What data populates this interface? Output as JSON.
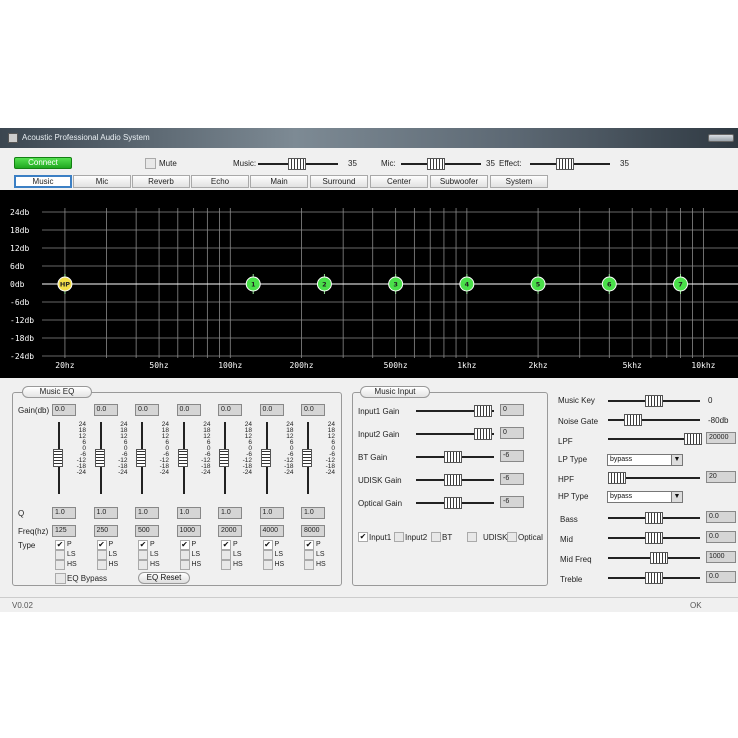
{
  "window": {
    "title": "Acoustic Professional Audio System"
  },
  "top": {
    "connect_label": "Connect",
    "mute_label": "Mute",
    "music_label": "Music:",
    "music_value": "35",
    "mic_label": "Mic:",
    "mic_value": "35",
    "effect_label": "Effect:",
    "effect_value": "35"
  },
  "tabs": [
    "Music",
    "Mic",
    "Reverb",
    "Echo",
    "Main",
    "Surround",
    "Center",
    "Subwoofer",
    "System"
  ],
  "selected_tab": "Music",
  "graph": {
    "db_labels": [
      "24db",
      "18db",
      "12db",
      "6db",
      "0db",
      "-6db",
      "-12db",
      "-18db",
      "-24db"
    ],
    "freq_labels": [
      "20hz",
      "50hz",
      "100hz",
      "200hz",
      "500hz",
      "1khz",
      "2khz",
      "5khz",
      "10khz"
    ],
    "points": [
      {
        "label": "HP",
        "freq_hz": 20,
        "gain_db": 0,
        "color": "#f4e04a"
      },
      {
        "label": "1",
        "freq_hz": 125,
        "gain_db": 0,
        "color": "#4ae04a"
      },
      {
        "label": "2",
        "freq_hz": 250,
        "gain_db": 0,
        "color": "#4ae04a"
      },
      {
        "label": "3",
        "freq_hz": 500,
        "gain_db": 0,
        "color": "#4ae04a"
      },
      {
        "label": "4",
        "freq_hz": 1000,
        "gain_db": 0,
        "color": "#4ae04a"
      },
      {
        "label": "5",
        "freq_hz": 2000,
        "gain_db": 0,
        "color": "#4ae04a"
      },
      {
        "label": "6",
        "freq_hz": 4000,
        "gain_db": 0,
        "color": "#4ae04a"
      },
      {
        "label": "7",
        "freq_hz": 8000,
        "gain_db": 0,
        "color": "#4ae04a"
      }
    ]
  },
  "music_eq": {
    "title": "Music EQ",
    "gain_label": "Gain(db)",
    "q_label": "Q",
    "freq_label": "Freq(hz)",
    "type_label": "Type",
    "scale_labels": [
      "24",
      "18",
      "12",
      "6",
      "0",
      "-6",
      "-12",
      "-18",
      "-24"
    ],
    "type_options": [
      "P",
      "LS",
      "HS"
    ],
    "bands": [
      {
        "gain": "0.0",
        "q": "1.0",
        "freq": "125"
      },
      {
        "gain": "0.0",
        "q": "1.0",
        "freq": "250"
      },
      {
        "gain": "0.0",
        "q": "1.0",
        "freq": "500"
      },
      {
        "gain": "0.0",
        "q": "1.0",
        "freq": "1000"
      },
      {
        "gain": "0.0",
        "q": "1.0",
        "freq": "2000"
      },
      {
        "gain": "0.0",
        "q": "1.0",
        "freq": "4000"
      },
      {
        "gain": "0.0",
        "q": "1.0",
        "freq": "8000"
      }
    ],
    "eq_bypass_label": "EQ Bypass",
    "eq_reset_label": "EQ Reset"
  },
  "music_input": {
    "title": "Music Input",
    "rows": [
      {
        "label": "Input1 Gain",
        "value": "0"
      },
      {
        "label": "Input2 Gain",
        "value": "0"
      },
      {
        "label": "BT Gain",
        "value": "-6"
      },
      {
        "label": "UDISK Gain",
        "value": "-6"
      },
      {
        "label": "Optical Gain",
        "value": "-6"
      }
    ],
    "sources": [
      {
        "label": "Input1",
        "checked": true
      },
      {
        "label": "Input2",
        "checked": false
      },
      {
        "label": "BT",
        "checked": false
      },
      {
        "label": "UDISK",
        "checked": false
      },
      {
        "label": "Optical",
        "checked": false
      }
    ]
  },
  "right_panel": {
    "music_key_label": "Music Key",
    "music_key_value": "0",
    "noise_gate_label": "Noise Gate",
    "noise_gate_value": "-80db",
    "lpf_label": "LPF",
    "lpf_value": "20000",
    "lp_type_label": "LP Type",
    "lp_type_value": "bypass",
    "hpf_label": "HPF",
    "hpf_value": "20",
    "hp_type_label": "HP Type",
    "hp_type_value": "bypass",
    "bass_label": "Bass",
    "bass_value": "0.0",
    "mid_label": "Mid",
    "mid_value": "0.0",
    "mid_freq_label": "Mid Freq",
    "mid_freq_value": "1000",
    "treble_label": "Treble",
    "treble_value": "0.0"
  },
  "status": {
    "version": "V0.02",
    "state": "OK"
  }
}
